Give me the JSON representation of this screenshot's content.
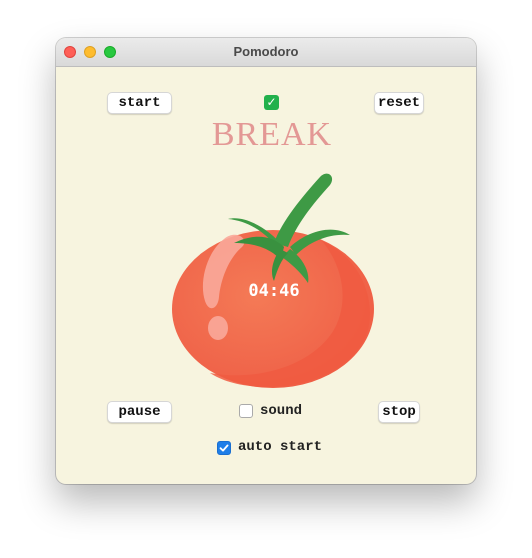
{
  "window": {
    "title": "Pomodoro"
  },
  "controls": {
    "start_label": "start",
    "reset_label": "reset",
    "pause_label": "pause",
    "stop_label": "stop"
  },
  "status": {
    "icon": "check-mark-icon",
    "mode": "BREAK",
    "timer": "04:46"
  },
  "options": {
    "sound_label": "sound",
    "sound_checked": false,
    "auto_start_label": "auto start",
    "auto_start_checked": true
  },
  "colors": {
    "mode_text": "#e39895",
    "tomato": "#f26a4b",
    "leaves": "#3e9a45",
    "checkbox_accent": "#1f7ee8",
    "background": "#f7f4df"
  }
}
